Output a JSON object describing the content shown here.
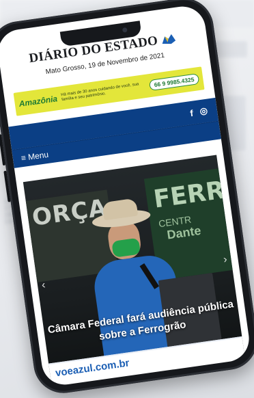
{
  "header": {
    "logo_text": "DIÁRIO DO ESTADO",
    "date_line": "Mato Grosso, 19 de Novembro de 2021"
  },
  "ad_banner": {
    "brand": "Amazônia",
    "tagline": "Há mais de 30 anos cuidando de você, sua família e seu patrimônio.",
    "phone": "66 9 9985.4325"
  },
  "social": {
    "facebook_glyph": "f",
    "instagram_glyph": "◎"
  },
  "nav": {
    "menu_label": "≡ Menu"
  },
  "hero": {
    "headline": "Câmara Federal fará audiência pública sobre a Ferrogrão",
    "banner_left_text": "ORÇA",
    "banner_right_text": "FERR",
    "banner_right_small": "CENTR",
    "banner_right_name": "Dante"
  },
  "footer_ad": {
    "text": "voeazul.com.br"
  },
  "colors": {
    "brand_blue": "#0b3f85",
    "ad_yellow": "#e3e63a",
    "ad_green": "#1e7a33"
  }
}
